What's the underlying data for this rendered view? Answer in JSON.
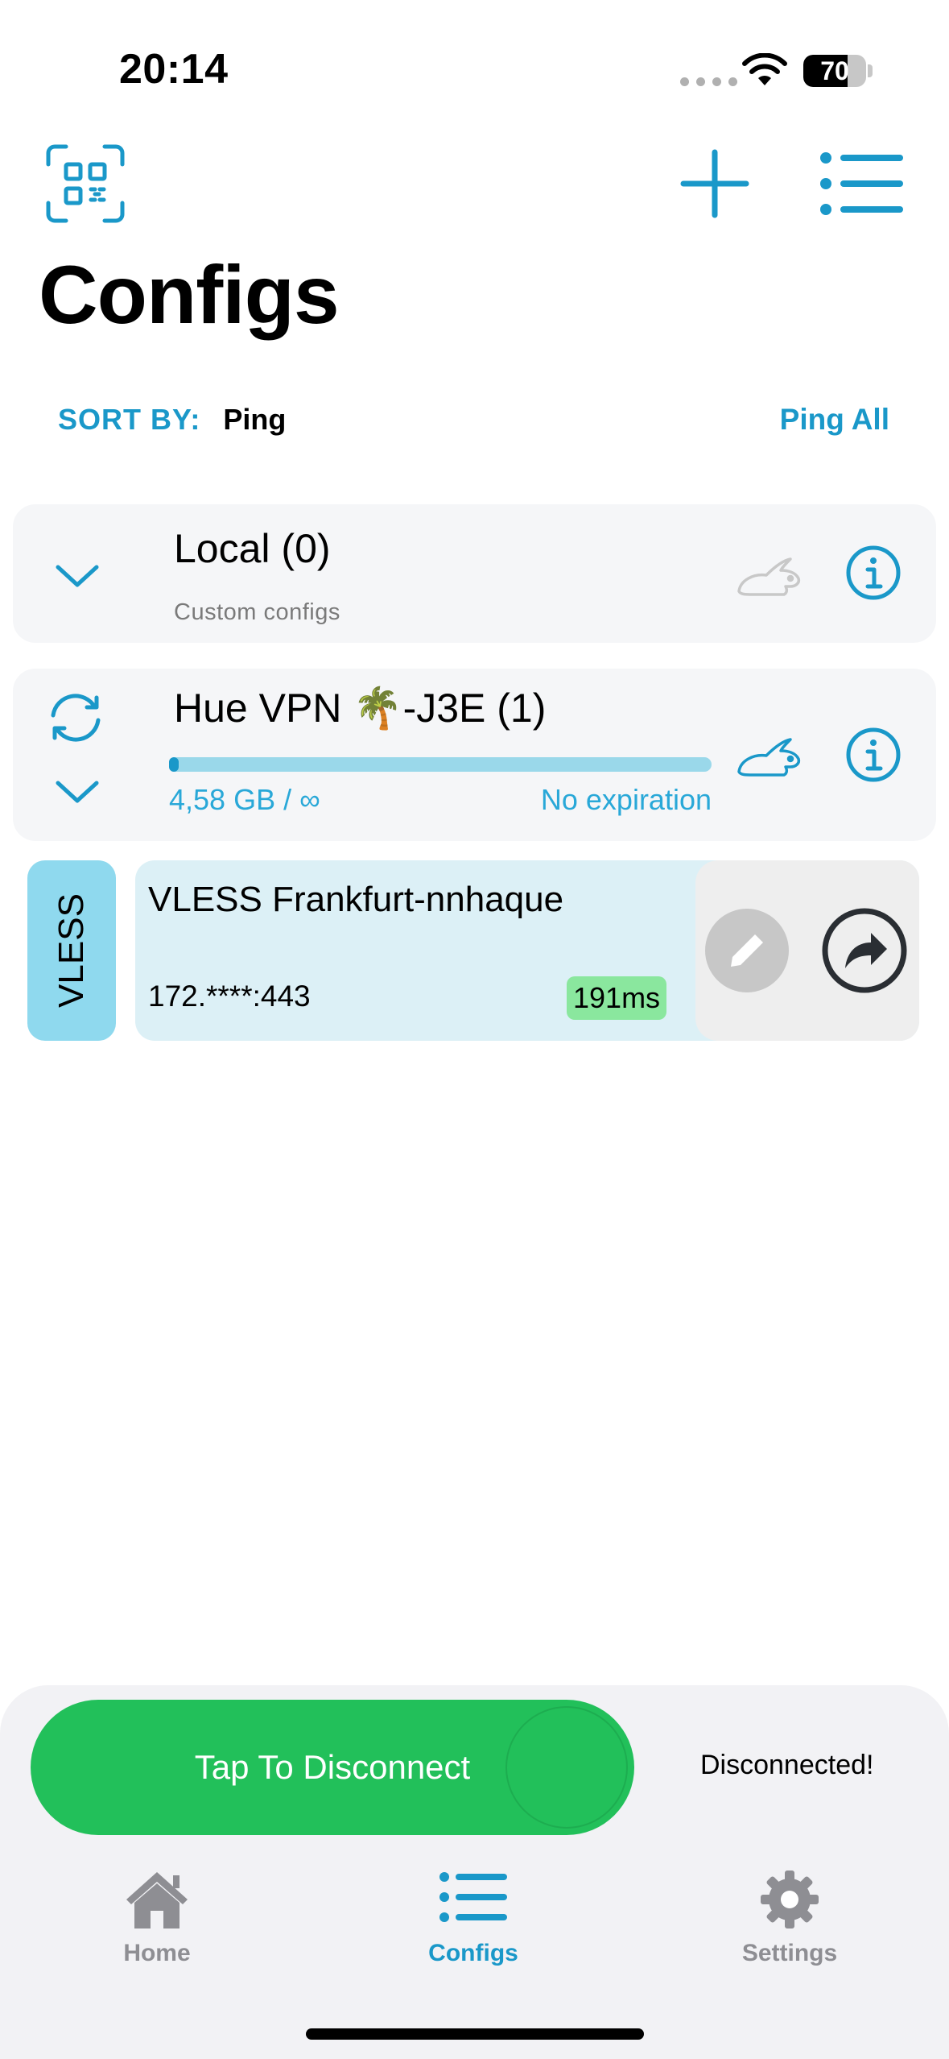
{
  "status_bar": {
    "time": "20:14",
    "battery_percent": "70",
    "icons": [
      "cellular-dots-icon",
      "wifi-icon",
      "battery-icon"
    ]
  },
  "header": {
    "title": "Configs",
    "left_icon": "qr-code-scan-icon",
    "right_icons": [
      "plus-icon",
      "list-icon"
    ]
  },
  "sort": {
    "label": "SORT BY:",
    "value": "Ping",
    "ping_all": "Ping All"
  },
  "groups": [
    {
      "title": "Local (0)",
      "subtitle": "Custom configs",
      "icons": [
        "chevron-down-icon",
        "rabbit-icon",
        "info-icon"
      ]
    },
    {
      "title": "Hue VPN 🌴-J3E (1)",
      "usage": "4,58 GB / ∞",
      "expiration": "No expiration",
      "usage_fraction": 0.01,
      "icons": [
        "refresh-icon",
        "chevron-down-icon",
        "rabbit-icon",
        "info-icon"
      ]
    }
  ],
  "config": {
    "protocol": "VLESS",
    "name": "VLESS Frankfurt-nnhaque",
    "address": "172.****:443",
    "ping": "191ms",
    "actions": [
      "pencil-icon",
      "share-arrow-icon"
    ]
  },
  "connection": {
    "button_label": "Tap To Disconnect",
    "status": "Disconnected!"
  },
  "tabs": [
    {
      "label": "Home",
      "icon": "home-icon",
      "active": false
    },
    {
      "label": "Configs",
      "icon": "list-icon",
      "active": true
    },
    {
      "label": "Settings",
      "icon": "gear-icon",
      "active": false
    }
  ],
  "colors": {
    "accent": "#1a98c9",
    "green": "#22c05a",
    "ping_badge": "#8ae79e",
    "protocol_tag": "#8fd9ee",
    "inactive_tab": "#8e8e93"
  }
}
